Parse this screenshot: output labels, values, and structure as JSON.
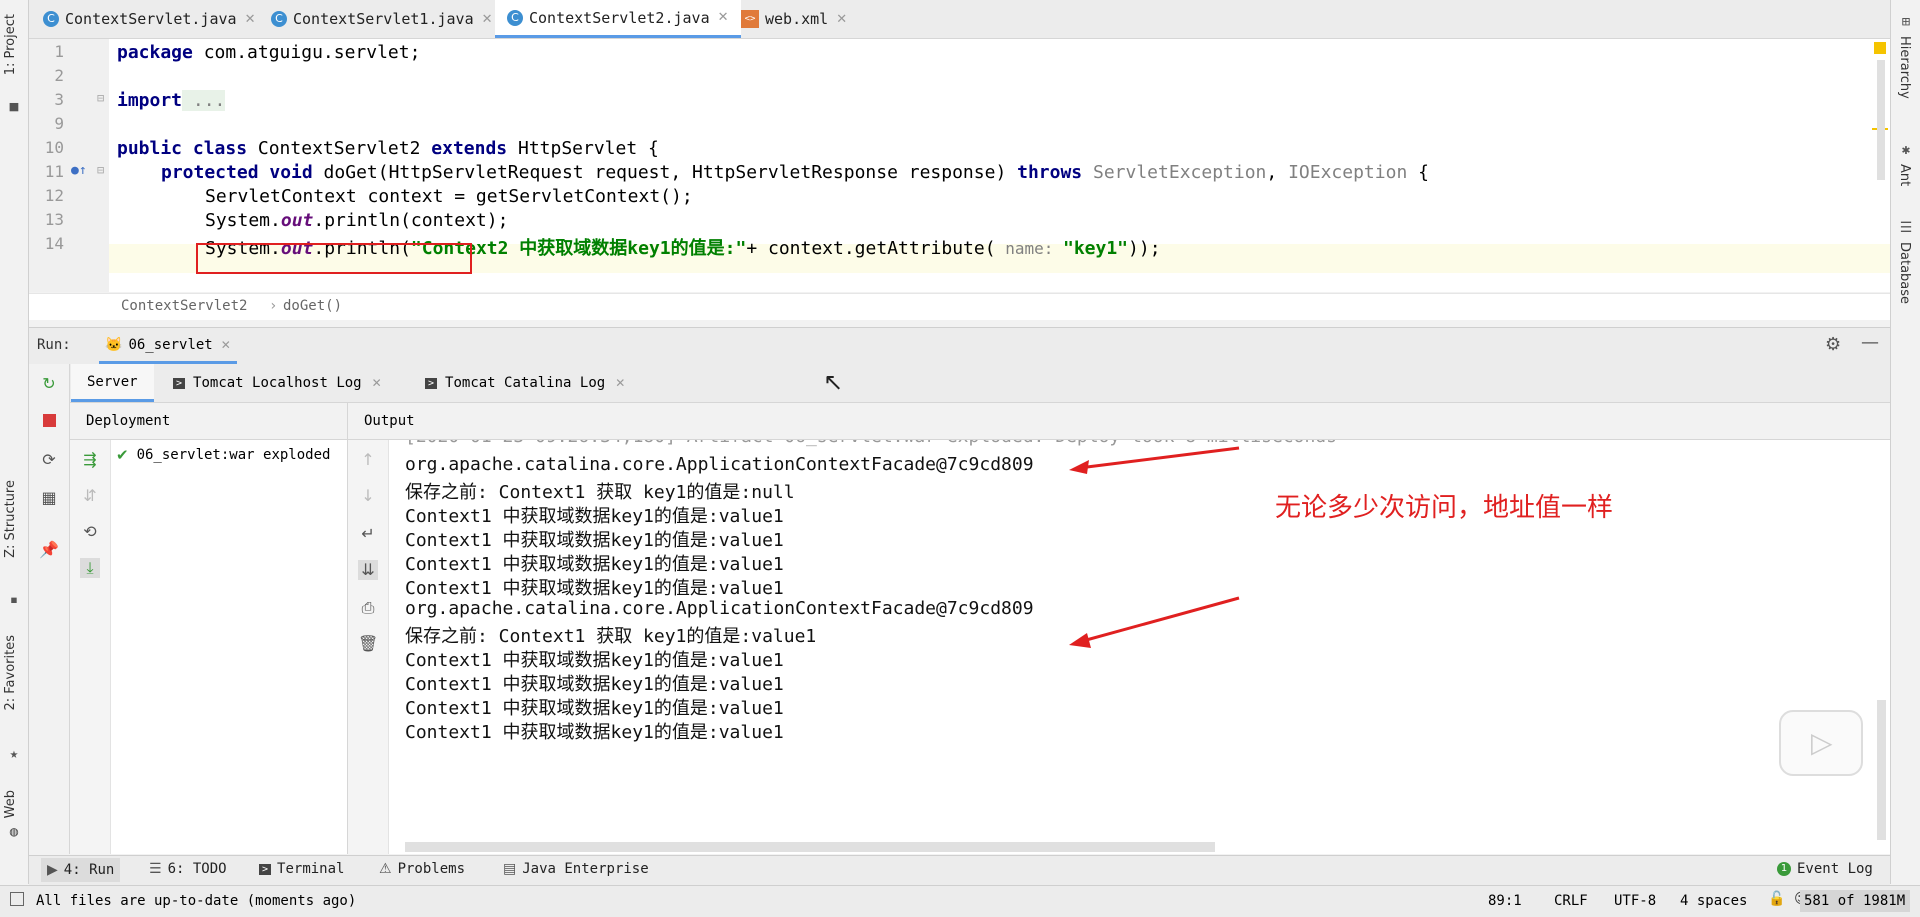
{
  "left_stripe": {
    "project": "1: Project",
    "structure": "Z: Structure",
    "favorites": "2: Favorites",
    "web": "Web"
  },
  "right_stripe": {
    "hierarchy": "Hierarchy",
    "ant": "Ant",
    "database": "Database"
  },
  "tabs": [
    {
      "label": "ContextServlet.java",
      "icon": "class-icon"
    },
    {
      "label": "ContextServlet1.java",
      "icon": "class-icon"
    },
    {
      "label": "ContextServlet2.java",
      "icon": "class-icon",
      "active": true
    },
    {
      "label": "web.xml",
      "icon": "xml-icon"
    }
  ],
  "editor": {
    "line_numbers": [
      "1",
      "2",
      "3",
      "9",
      "10",
      "11",
      "12",
      "13",
      "14"
    ],
    "lines": {
      "l1_kw": "package",
      "l1_rest": " com.atguigu.servlet;",
      "l3_kw": "import",
      "l3_rest": " ...",
      "l10_kw1": "public class",
      "l10_mid": " ContextServlet2 ",
      "l10_kw2": "extends",
      "l10_rest": " HttpServlet {",
      "l11_kw": "protected void",
      "l11_mid": " doGet(HttpServletRequest request, HttpServletResponse response) ",
      "l11_kw2": "throws",
      "l11_ex1": " ServletException",
      "l11_sep": ", ",
      "l11_ex2": "IOException",
      "l11_end": " {",
      "l12": "ServletContext context = getServletContext();",
      "l13_a": "System.",
      "l13_out": "out",
      "l13_b": ".println(context);",
      "l14_a": "System.",
      "l14_out": "out",
      "l14_b": ".println(",
      "l14_str": "\"Context2 中获取域数据key1的值是:\"",
      "l14_c": "+ context.getAttribute(",
      "l14_hint": " name: ",
      "l14_str2": "\"key1\"",
      "l14_end": "));"
    },
    "breadcrumb": [
      "ContextServlet2",
      "doGet()"
    ]
  },
  "run": {
    "label": "Run:",
    "config": "06_servlet",
    "tabs": [
      {
        "label": "Server"
      },
      {
        "label": "Tomcat Localhost Log"
      },
      {
        "label": "Tomcat Catalina Log"
      }
    ],
    "deployment_header": "Deployment",
    "deployment_item": "06_servlet:war exploded",
    "output_header": "Output",
    "output_lines": [
      "org.apache.catalina.core.ApplicationContextFacade@7c9cd809",
      "保存之前: Context1 获取 key1的值是:null",
      "Context1 中获取域数据key1的值是:value1",
      "Context1 中获取域数据key1的值是:value1",
      "Context1 中获取域数据key1的值是:value1",
      "Context1 中获取域数据key1的值是:value1",
      "org.apache.catalina.core.ApplicationContextFacade@7c9cd809",
      "保存之前: Context1 获取 key1的值是:value1",
      "Context1 中获取域数据key1的值是:value1",
      "Context1 中获取域数据key1的值是:value1",
      "Context1 中获取域数据key1的值是:value1",
      "Context1 中获取域数据key1的值是:value1"
    ],
    "annotation": "无论多少次访问，地址值一样"
  },
  "bottom_tabs": [
    {
      "label": "4: Run"
    },
    {
      "label": "6: TODO"
    },
    {
      "label": "Terminal"
    },
    {
      "label": "Problems"
    },
    {
      "label": "Java Enterprise"
    },
    {
      "label": "Event Log"
    }
  ],
  "status": {
    "message": "All files are up-to-date (moments ago)",
    "position": "89:1",
    "line_sep": "CRLF",
    "encoding": "UTF-8",
    "indent": "4 spaces",
    "memory": "581 of 1981M"
  },
  "colors": {
    "accent": "#5a9be6",
    "annotation_red": "#e02020",
    "keyword": "#000080",
    "string": "#008000"
  }
}
